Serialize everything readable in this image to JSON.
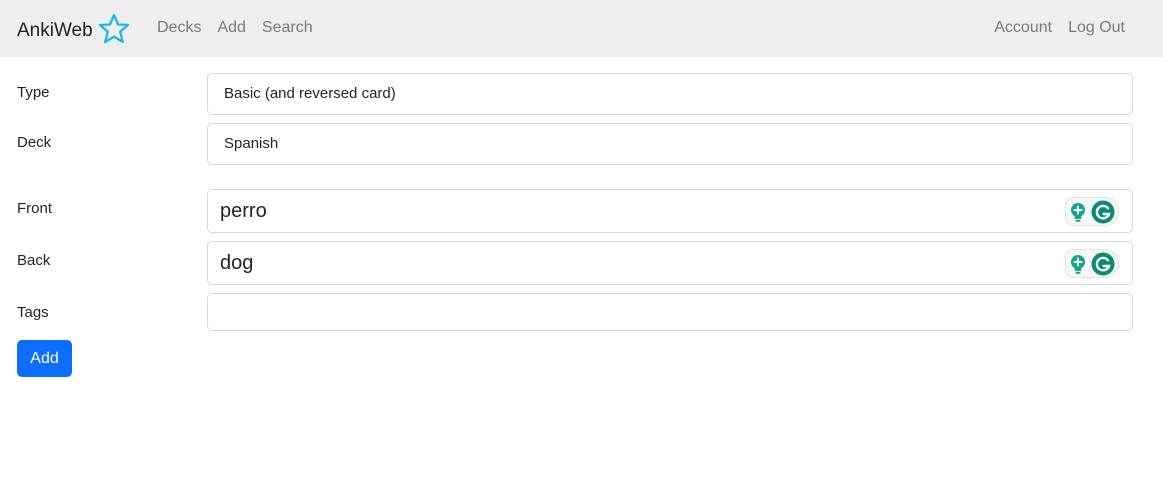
{
  "navbar": {
    "brand": "AnkiWeb",
    "links_left": [
      "Decks",
      "Add",
      "Search"
    ],
    "links_right": [
      "Account",
      "Log Out"
    ]
  },
  "form": {
    "type": {
      "label": "Type",
      "value": "Basic (and reversed card)"
    },
    "deck": {
      "label": "Deck",
      "value": "Spanish"
    },
    "front": {
      "label": "Front",
      "value": "perro"
    },
    "back": {
      "label": "Back",
      "value": "dog"
    },
    "tags": {
      "label": "Tags",
      "value": ""
    },
    "add_label": "Add"
  },
  "colors": {
    "navbar_bg": "#eeeeee",
    "brand_star": "#22b4e8",
    "primary": "#0d6efd",
    "grammarly_green": "#15a58a"
  }
}
